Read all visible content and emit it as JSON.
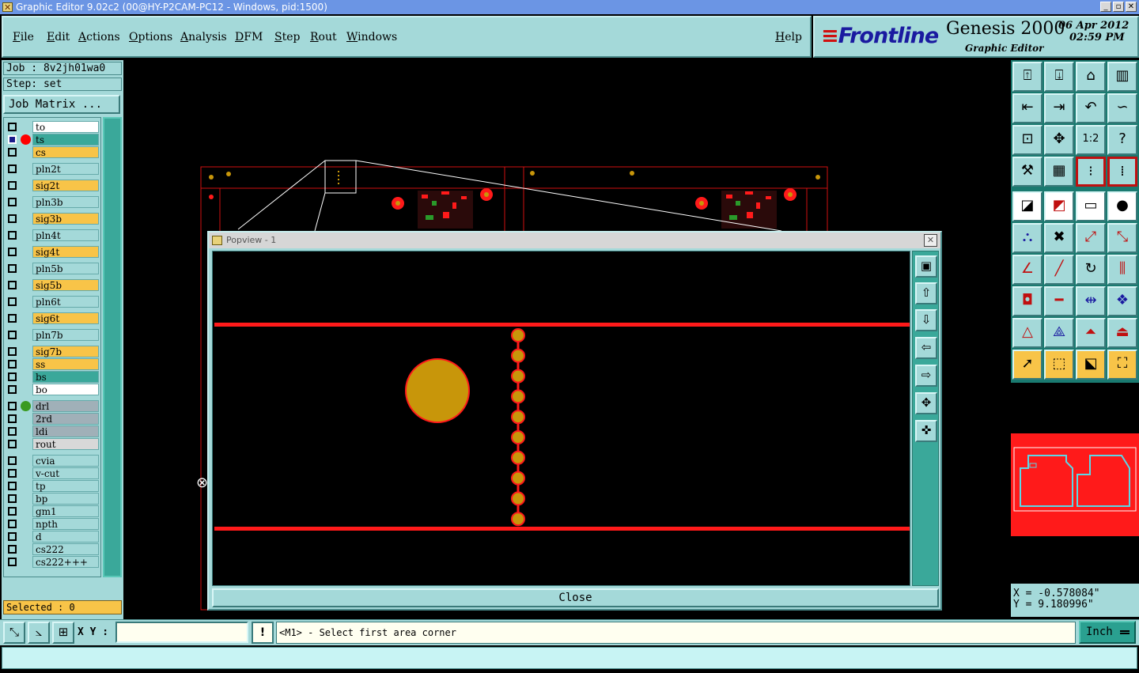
{
  "window": {
    "title": "Graphic Editor 9.02c2 (00@HY-P2CAM-PC12 - Windows, pid:1500)"
  },
  "menu": [
    {
      "label": "File",
      "u": "F",
      "rest": "ile"
    },
    {
      "label": "Edit",
      "u": "E",
      "rest": "dit"
    },
    {
      "label": "Actions",
      "u": "A",
      "rest": "ctions"
    },
    {
      "label": "Options",
      "u": "O",
      "rest": "ptions"
    },
    {
      "label": "Analysis",
      "u": "A",
      "rest": "nalysis"
    },
    {
      "label": "DFM",
      "u": "D",
      "rest": "FM"
    },
    {
      "label": "Step",
      "u": "S",
      "rest": "tep"
    },
    {
      "label": "Rout",
      "u": "R",
      "rest": "out"
    },
    {
      "label": "Windows",
      "u": "W",
      "rest": "indows"
    },
    {
      "label": "Help",
      "u": "H",
      "rest": "elp"
    }
  ],
  "brand": {
    "logo": "Frontline",
    "product": "Genesis 2000",
    "subtitle": "Graphic Editor",
    "date": "06 Apr 2012",
    "time": "02:59 PM"
  },
  "job": {
    "job_text": "Job : 8v2jh01wa0",
    "step_text": "Step: set",
    "matrix_button": "Job Matrix ..."
  },
  "layers": [
    {
      "name": "to",
      "color": "#ffffff"
    },
    {
      "name": "ts",
      "color": "#3aa89a",
      "selected": true,
      "dot": "#ff0000"
    },
    {
      "name": "cs",
      "color": "#f8c448"
    },
    {
      "name": "pln2t",
      "color": "#a4d9d9"
    },
    {
      "name": "sig2t",
      "color": "#f8c448"
    },
    {
      "name": "pln3b",
      "color": "#a4d9d9"
    },
    {
      "name": "sig3b",
      "color": "#f8c448"
    },
    {
      "name": "pln4t",
      "color": "#a4d9d9"
    },
    {
      "name": "sig4t",
      "color": "#f8c448"
    },
    {
      "name": "pln5b",
      "color": "#a4d9d9"
    },
    {
      "name": "sig5b",
      "color": "#f8c448"
    },
    {
      "name": "pln6t",
      "color": "#a4d9d9"
    },
    {
      "name": "sig6t",
      "color": "#f8c448"
    },
    {
      "name": "pln7b",
      "color": "#a4d9d9"
    },
    {
      "name": "sig7b",
      "color": "#f8c448"
    },
    {
      "name": "ss",
      "color": "#f8c448"
    },
    {
      "name": "bs",
      "color": "#3aa89a"
    },
    {
      "name": "bo",
      "color": "#ffffff"
    },
    {
      "name": "drl",
      "color": "#a0b0b8",
      "dot": "#3a9a20"
    },
    {
      "name": "2rd",
      "color": "#a0b0b8"
    },
    {
      "name": "ldi",
      "color": "#a0b0b8"
    },
    {
      "name": "rout",
      "color": "#d8d8d8"
    },
    {
      "name": "cvia",
      "color": "#a4d9d9"
    },
    {
      "name": "v-cut",
      "color": "#a4d9d9"
    },
    {
      "name": "tp",
      "color": "#a4d9d9"
    },
    {
      "name": "bp",
      "color": "#a4d9d9"
    },
    {
      "name": "gm1",
      "color": "#a4d9d9"
    },
    {
      "name": "npth",
      "color": "#a4d9d9"
    },
    {
      "name": "d",
      "color": "#a4d9d9"
    },
    {
      "name": "cs222",
      "color": "#a4d9d9"
    },
    {
      "name": "cs222+++",
      "color": "#a4d9d9"
    }
  ],
  "selected_text": "Selected : 0",
  "popview": {
    "title": "Popview - 1",
    "close_label": "Close",
    "close_x": "✕"
  },
  "coords": {
    "x_text": "X = -0.578084\"",
    "y_text": "Y = 9.180996\""
  },
  "bottom": {
    "xy_label": "X Y :",
    "xy_value": "",
    "prompt": "<M1> - Select first area corner",
    "units": "Inch",
    "warn": "!"
  },
  "colors": {
    "panel": "#a4d9d9",
    "accent": "#3aa89a",
    "copper": "#c8960a",
    "trace": "#ff1a1a"
  }
}
